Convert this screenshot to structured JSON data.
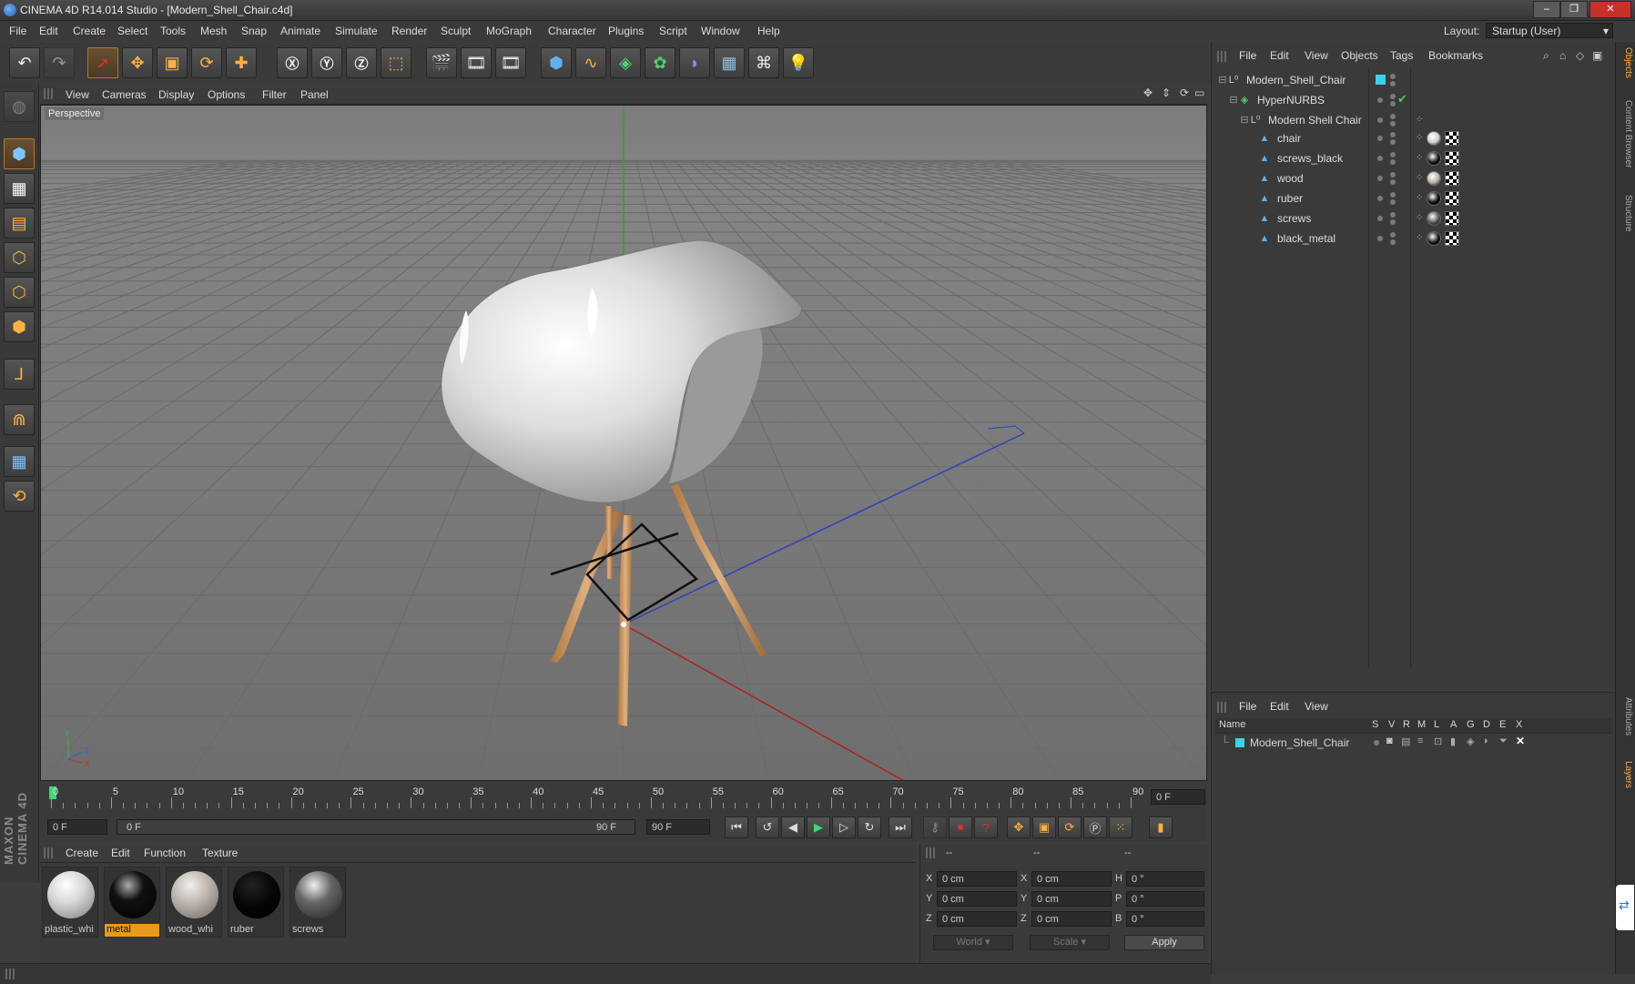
{
  "window": {
    "title": "CINEMA 4D R14.014 Studio - [Modern_Shell_Chair.c4d]",
    "minimize": "–",
    "restore": "❐",
    "close": "✕"
  },
  "menu": [
    "File",
    "Edit",
    "Create",
    "Select",
    "Tools",
    "Mesh",
    "Snap",
    "Animate",
    "Simulate",
    "Render",
    "Sculpt",
    "MoGraph",
    "Character",
    "Plugins",
    "Script",
    "Window",
    "Help"
  ],
  "layout": {
    "label": "Layout:",
    "value": "Startup (User)"
  },
  "viewport": {
    "menu": [
      "View",
      "Cameras",
      "Display",
      "Options",
      "Filter",
      "Panel"
    ],
    "camera_label": "Perspective",
    "axis_y": "Y",
    "axis_z": "Z",
    "axis_x": "X"
  },
  "timeline": {
    "ticks": [
      "0",
      "5",
      "10",
      "15",
      "20",
      "25",
      "30",
      "35",
      "40",
      "45",
      "50",
      "55",
      "60",
      "65",
      "70",
      "75",
      "80",
      "85",
      "90"
    ],
    "current_frame": "0 F",
    "start_field": "0 F",
    "range_start": "0 F",
    "range_end": "90 F",
    "end_field": "90 F"
  },
  "material_manager": {
    "menu": [
      "Create",
      "Edit",
      "Function",
      "Texture"
    ],
    "materials": [
      {
        "name": "plastic_whi",
        "selected": false
      },
      {
        "name": "metal",
        "selected": true
      },
      {
        "name": "wood_whi",
        "selected": false
      },
      {
        "name": "ruber",
        "selected": false
      },
      {
        "name": "screws",
        "selected": false
      }
    ]
  },
  "coordinates": {
    "headers": [
      "--",
      "--",
      "--"
    ],
    "rows": [
      {
        "a": "X",
        "a_val": "0 cm",
        "b": "X",
        "b_val": "0 cm",
        "c": "H",
        "c_val": "0 °"
      },
      {
        "a": "Y",
        "a_val": "0 cm",
        "b": "Y",
        "b_val": "0 cm",
        "c": "P",
        "c_val": "0 °"
      },
      {
        "a": "Z",
        "a_val": "0 cm",
        "b": "Z",
        "b_val": "0 cm",
        "c": "B",
        "c_val": "0 °"
      }
    ],
    "mode1": "World",
    "mode2": "Scale",
    "apply": "Apply"
  },
  "object_manager": {
    "menu": [
      "File",
      "Edit",
      "View",
      "Objects",
      "Tags",
      "Bookmarks"
    ],
    "objects": [
      {
        "name": "Modern_Shell_Chair",
        "level": 0,
        "type": "null"
      },
      {
        "name": "HyperNURBS",
        "level": 1,
        "type": "hypernurbs"
      },
      {
        "name": "Modern Shell Chair",
        "level": 2,
        "type": "null"
      },
      {
        "name": "chair",
        "level": 3,
        "type": "poly",
        "mat": "#cfcfcf"
      },
      {
        "name": "screws_black",
        "level": 3,
        "type": "poly",
        "mat": "#111111"
      },
      {
        "name": "wood",
        "level": 3,
        "type": "poly",
        "mat": "#b8b0a8"
      },
      {
        "name": "ruber",
        "level": 3,
        "type": "poly",
        "mat": "#0a0a0a"
      },
      {
        "name": "screws",
        "level": 3,
        "type": "poly",
        "mat": "#555555"
      },
      {
        "name": "black_metal",
        "level": 3,
        "type": "poly",
        "mat": "#151515"
      }
    ]
  },
  "layer_manager": {
    "menu": [
      "File",
      "Edit",
      "View"
    ],
    "columns": [
      "Name",
      "S",
      "V",
      "R",
      "M",
      "L",
      "A",
      "G",
      "D",
      "E",
      "X"
    ],
    "layers": [
      {
        "name": "Modern_Shell_Chair",
        "color": "#3ad4e8"
      }
    ]
  },
  "side_tabs": [
    "Objects",
    "Content Browser",
    "Structure",
    "Attributes",
    "Layers"
  ],
  "branding": "MAXON CINEMA 4D",
  "colors": {
    "accent": "#e89a1a",
    "layer": "#3ad4e8",
    "viewport_bg": "#8c8c8c"
  }
}
